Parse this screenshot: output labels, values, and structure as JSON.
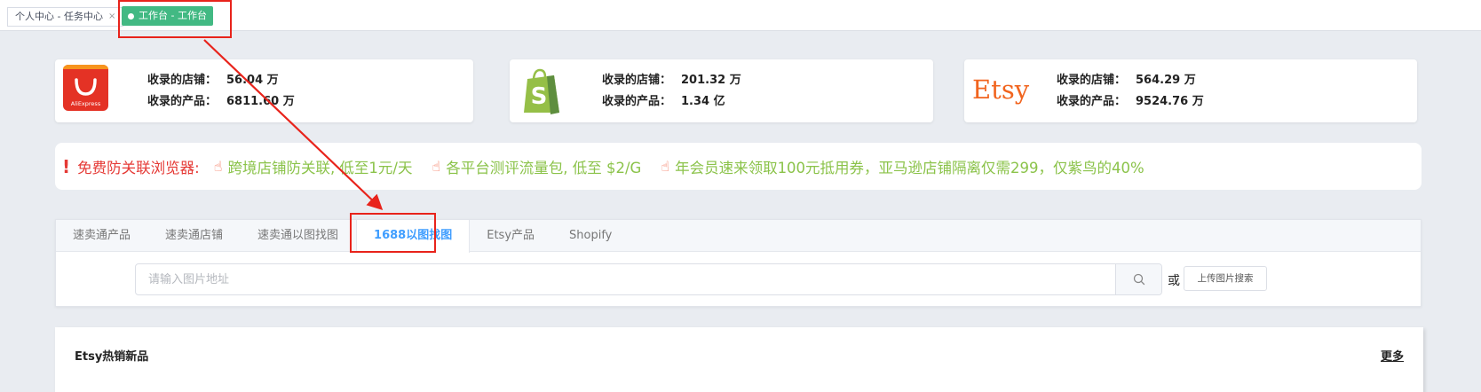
{
  "tabbar": {
    "tab1_label": "个人中心 - 任务中心",
    "tab1_close": "×",
    "tab2_label": "工作台 - 工作台"
  },
  "cards": [
    {
      "platform": "AliExpress",
      "logo_text": "AliExpress",
      "shops_label": "收录的店铺：",
      "shops_value": "56.04 万",
      "products_label": "收录的产品：",
      "products_value": "6811.60 万"
    },
    {
      "platform": "Shopify",
      "logo_text": "S",
      "shops_label": "收录的店铺：",
      "shops_value": "201.32 万",
      "products_label": "收录的产品：",
      "products_value": "1.34 亿"
    },
    {
      "platform": "Etsy",
      "logo_text": "Etsy",
      "shops_label": "收录的店铺：",
      "shops_value": "564.29 万",
      "products_label": "收录的产品：",
      "products_value": "9524.76 万"
    }
  ],
  "banner": {
    "warn_icon": "!",
    "title": "免费防关联浏览器:",
    "links": [
      "跨境店铺防关联, 低至1元/天",
      "各平台测评流量包, 低至 $2/G",
      "年会员速来领取100元抵用券，亚马逊店铺隔离仅需299，仅紫鸟的40%"
    ],
    "link_icon": "hand-pointer-icon"
  },
  "search_panel": {
    "tabs": [
      "速卖通产品",
      "速卖通店铺",
      "速卖通以图找图",
      "1688以图找图",
      "Etsy产品",
      "Shopify"
    ],
    "active_tab": "1688以图找图",
    "placeholder": "请输入图片地址",
    "value": "",
    "or_text": "或",
    "upload_label": "上传图片搜索"
  },
  "hot_section": {
    "title": "Etsy热销新品",
    "more_label": "更多"
  },
  "colors": {
    "accent": "#409eff",
    "active_tag": "#42b983",
    "warn": "#e53935",
    "link": "#8bc34a",
    "annotation": "#e8231b"
  }
}
